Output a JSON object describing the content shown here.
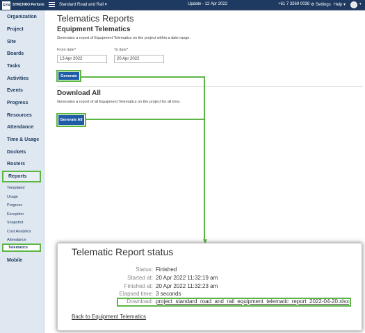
{
  "topbar": {
    "logo_mark": "SYN",
    "logo_text": "SYNCHRO Perform",
    "project_select": "Standard Road and Rail ▾",
    "update": "Update - 12 Apr 2022",
    "phone": "+61 7 3369 0038",
    "settings": "⚙ Settings",
    "help": "Help ▾"
  },
  "sidebar": {
    "items": [
      "Organization",
      "Project",
      "Site",
      "Boards",
      "Tasks",
      "Activities",
      "Events",
      "Progress",
      "Resources",
      "Attendance",
      "Time & Usage",
      "Dockets",
      "Rosters",
      "Reports"
    ],
    "sub_items": [
      "Templated",
      "Usage",
      "Progress",
      "Exception",
      "Snapshot",
      "Cost Analytics",
      "Attendance",
      "Telematics"
    ],
    "bottom_item": "Mobile",
    "active_item": "Reports",
    "active_sub_item": "Telematics"
  },
  "main": {
    "page_title": "Telematics Reports",
    "equipment": {
      "title": "Equipment Telematics",
      "description": "Generates a report of Equipment Telematics on the project within a date range.",
      "from_label": "From date*",
      "from_value": "13 Apr 2022",
      "to_label": "To date*",
      "to_value": "20 Apr 2022",
      "button": "Generate"
    },
    "download_all": {
      "title": "Download All",
      "description": "Generates a report of all Equipment Telematics on the project for all time.",
      "button": "Generate All"
    }
  },
  "popup": {
    "title": "Telematic Report status",
    "rows": [
      {
        "label": "Status:",
        "value": "Finished"
      },
      {
        "label": "Started at:",
        "value": "20 Apr 2022 11:32:19 am"
      },
      {
        "label": "Finished at:",
        "value": "20 Apr 2022 11:32:23 am"
      },
      {
        "label": "Elapsed time:",
        "value": "3 seconds"
      },
      {
        "label": "Download:",
        "value": "project_standard_road_and_rail_equipment_telematic_report_2022-04-20.xlsx"
      }
    ],
    "back_link": "Back to Equipment Telematics"
  },
  "colors": {
    "topbar": "#1f3a60",
    "sidebar": "#dfe7f0",
    "highlight": "#5cb646",
    "button": "#1f5ca8"
  }
}
